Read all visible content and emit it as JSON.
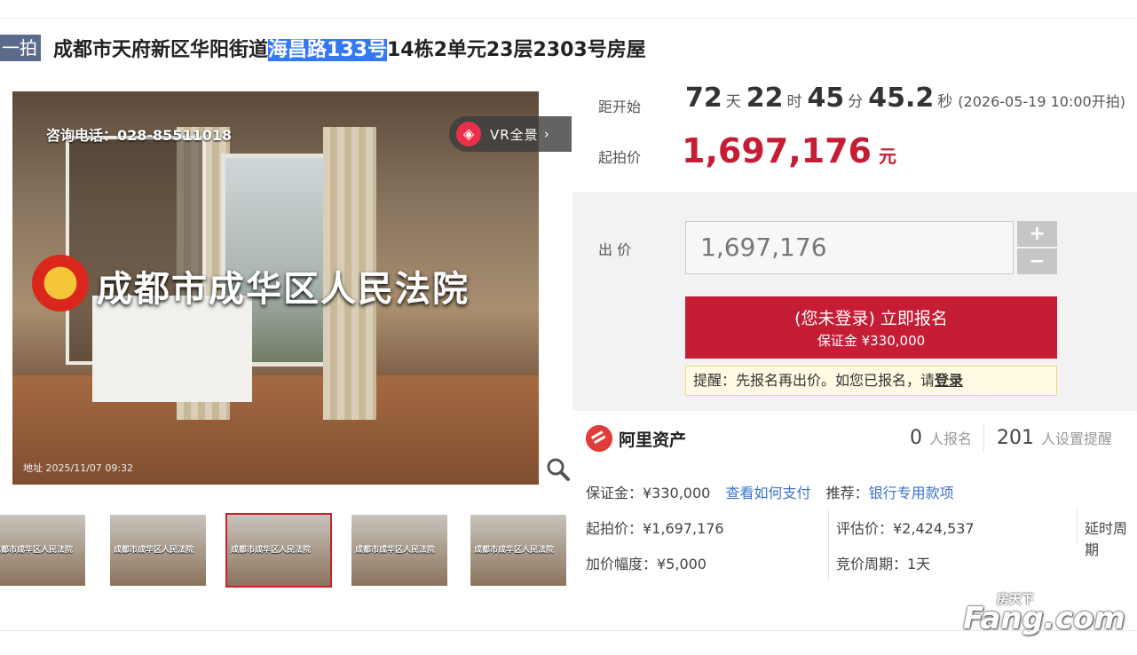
{
  "header": {
    "tag": "一拍",
    "title_before": "成都市天府新区华阳街道",
    "title_highlight": "海昌路133号",
    "title_after": "14栋2单元23层2303号房屋"
  },
  "photo": {
    "phone_text": "咨询电话：028-85511018",
    "court_text": "成都市成华区人民法院",
    "timestamp": "地址 2025/11/07 09:32",
    "vr_label": "VR全景",
    "vr_chevron": "›"
  },
  "thumbnails": [
    {
      "caption": "成都市成华区人民法院",
      "active": false
    },
    {
      "caption": "成都市成华区人民法院",
      "active": false
    },
    {
      "caption": "成都市成华区人民法院",
      "active": true
    },
    {
      "caption": "成都市成华区人民法院",
      "active": false
    },
    {
      "caption": "成都市成华区人民法院",
      "active": false
    }
  ],
  "auction": {
    "countdown_label": "距开始",
    "days": "72",
    "days_unit": "天",
    "hours": "22",
    "hours_unit": "时",
    "minutes": "45",
    "minutes_unit": "分",
    "seconds": "45.2",
    "seconds_unit": "秒",
    "start_time": "(2026-05-19 10:00开拍)",
    "start_price_label": "起拍价",
    "start_price": "1,697,176",
    "start_price_unit": "元"
  },
  "bid": {
    "label": "出 价",
    "value": "1,697,176",
    "plus": "+",
    "minus": "−",
    "signup_line1": "(您未登录) 立即报名",
    "signup_line2": "保证金 ¥330,000",
    "reminder_text": "提醒：先报名再出价。如您已报名，请",
    "reminder_login": "登录"
  },
  "platform": {
    "name": "阿里资产",
    "signups_count": "0",
    "signups_label": "人报名",
    "reminders_count": "201",
    "reminders_label": "人设置提醒"
  },
  "details": {
    "deposit": "保证金：¥330,000",
    "how_to_pay": "查看如何支付",
    "recommend_label": "推荐：",
    "recommend_link": "银行专用款项",
    "start_price": "起拍价：¥1,697,176",
    "appraisal": "评估价：¥2,424,537",
    "delay": "延时周期",
    "increment": "加价幅度：¥5,000",
    "period": "竞价周期：1天"
  },
  "watermark": {
    "cn": "房天下",
    "en": "Fang.com"
  },
  "colors": {
    "accent_red": "#c51d35",
    "link_blue": "#3a73c9",
    "tag_bg": "#5b6b8c",
    "highlight": "#3478f6"
  }
}
